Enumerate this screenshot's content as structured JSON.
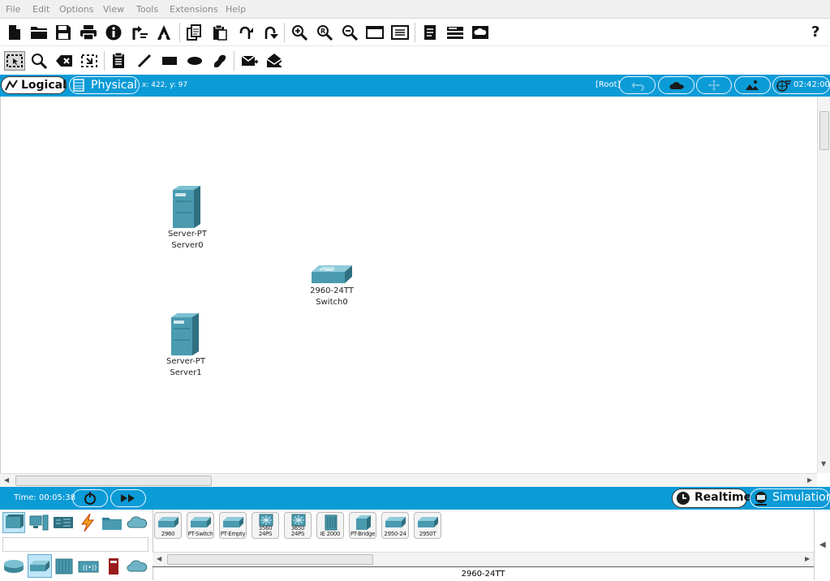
{
  "menu": [
    "File",
    "Edit",
    "Options",
    "View",
    "Tools",
    "Extensions",
    "Help"
  ],
  "toolbar_main": [
    "new-file-icon",
    "open-folder-icon",
    "save-icon",
    "print-icon",
    "info-icon",
    "network-wizard-icon",
    "activity-wizard-icon",
    "copy-icon",
    "paste-icon",
    "undo-icon",
    "redo-icon",
    "zoom-in-icon",
    "zoom-reset-icon",
    "zoom-out-icon",
    "drawing-palette-icon",
    "custom-device-dialog-icon",
    "pdu-list-icon",
    "command-log-icon",
    "cloud-capture-icon"
  ],
  "help_icon": "?",
  "toolbar_tools": [
    "select-icon",
    "inspect-icon",
    "delete-icon",
    "resize-shape-icon",
    "place-note-icon",
    "draw-line-icon",
    "draw-rectangle-icon",
    "draw-ellipse-icon",
    "freeform-icon",
    "add-simple-pdu-icon",
    "add-complex-pdu-icon"
  ],
  "workspace_bar": {
    "logical_label": "Logical",
    "physical_label": "Physical",
    "coords": "x: 422, y: 97",
    "root_label": "[Root]",
    "clock": "02:42:00"
  },
  "devices": [
    {
      "model": "Server-PT",
      "name": "Server0",
      "type": "server"
    },
    {
      "model": "2960-24TT",
      "name": "Switch0",
      "type": "switch"
    },
    {
      "model": "Server-PT",
      "name": "Server1",
      "type": "server"
    }
  ],
  "timebar": {
    "time_label": "Time: 00:05:38",
    "realtime_label": "Realtime",
    "simulation_label": "Simulation"
  },
  "device_categories_top": [
    "network-devices-icon",
    "end-devices-icon",
    "components-icon",
    "connections-icon",
    "miscellaneous-icon",
    "multiuser-icon"
  ],
  "device_categories_sub": [
    "routers-icon",
    "switches-icon",
    "hubs-icon",
    "wireless-devices-icon",
    "security-icon",
    "wan-emulation-icon"
  ],
  "device_tiles": [
    "2960",
    "PT-Switch",
    "PT-Empty",
    "3560 24PS",
    "3650 24PS",
    "IE 2000",
    "PT-Bridge",
    "2950-24",
    "2950T"
  ],
  "selected_device_name": "2960-24TT",
  "colors": {
    "accent_blue": "#0b9bd7",
    "device_teal": "#4a9bb0"
  }
}
